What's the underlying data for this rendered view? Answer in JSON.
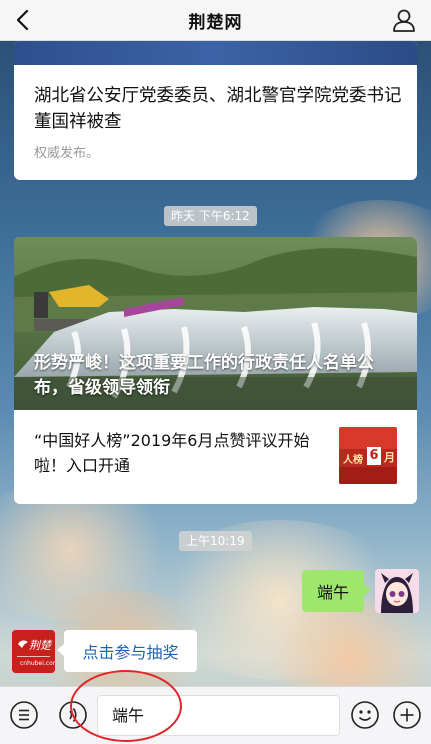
{
  "navbar": {
    "title": "荆楚网",
    "back_icon": "chevron-left-icon",
    "profile_icon": "person-icon"
  },
  "card1": {
    "title": "湖北省公安厅党委委员、湖北警官学院党委书记董国祥被查",
    "source": "权威发布。"
  },
  "timestamps": {
    "first": "昨天 下午6:12",
    "second": "上午10:19"
  },
  "card2": {
    "hero_title": "形势严峻！这项重要工作的行政责任人名单公布，省级领导领衔",
    "item_title": "“中国好人榜”2019年6月点赞评议开始啦！入口开通",
    "thumb_text_1": "人榜",
    "thumb_text_2": "6",
    "thumb_text_3": "月"
  },
  "chat": {
    "sent_message": "端午",
    "received_link": "点击参与抽奖",
    "sender_logo_text": "荆楚网"
  },
  "input_bar": {
    "value": "端午",
    "menu_icon": "list-menu-icon",
    "voice_icon": "voice-icon",
    "emoji_icon": "emoji-icon",
    "add_icon": "plus-circle-icon"
  },
  "colors": {
    "accent_green": "#9fe66d",
    "link_blue": "#1e64b4",
    "annotation_red": "#e0262a"
  }
}
